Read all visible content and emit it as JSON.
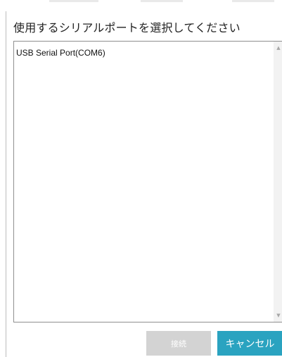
{
  "dialog": {
    "title": "使用するシリアルポートを選択してください",
    "ports": [
      "USB Serial Port(COM6)"
    ],
    "buttons": {
      "connect_label": "接続",
      "cancel_label": "キャンセル"
    }
  },
  "colors": {
    "cancel_button": "#2aa3c0",
    "connect_button_disabled": "#d3d3d3",
    "listbox_border": "#8f8f8f"
  },
  "icons": {
    "scroll_up": "scroll-up-arrow-icon",
    "scroll_down": "scroll-down-arrow-icon"
  }
}
